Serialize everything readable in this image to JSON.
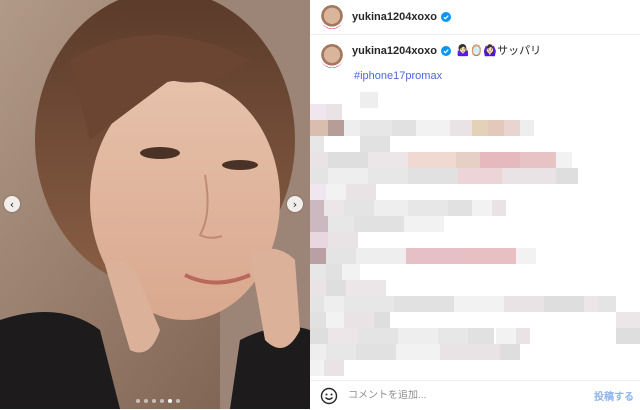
{
  "post": {
    "username": "yukina1204xoxo",
    "caption_emoji": "🤷🏻‍♀️🪞🙆🏻‍♀️",
    "caption": "サッパリ",
    "hashtag": "#iphone17promax"
  },
  "carousel": {
    "total_slides": 6,
    "active_slide": 5
  },
  "comment": {
    "placeholder": "コメントを追加...",
    "post_label": "投稿する"
  },
  "colors": {
    "hashtag": "#4c68d7",
    "post_button": "#8fb4ef",
    "verified": "#0095f6"
  },
  "icons": [
    "chevron-left-icon",
    "chevron-right-icon",
    "verified-badge-icon",
    "emoji-icon"
  ]
}
